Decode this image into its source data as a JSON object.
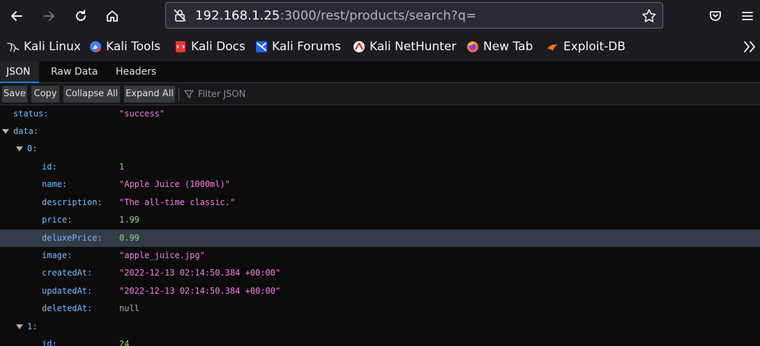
{
  "browser": {
    "url_host": "192.168.1.25",
    "url_rest": ":3000/rest/products/search?q=",
    "icons": [
      "back-icon",
      "forward-icon",
      "reload-icon",
      "home-icon",
      "lock-icon",
      "star-icon",
      "pocket-icon",
      "menu-icon"
    ]
  },
  "bookmarks": [
    {
      "label": "Kali Linux",
      "icon": "kali-dragon-icon"
    },
    {
      "label": "Kali Tools",
      "icon": "kali-tools-icon"
    },
    {
      "label": "Kali Docs",
      "icon": "kali-docs-icon"
    },
    {
      "label": "Kali Forums",
      "icon": "kali-forums-icon"
    },
    {
      "label": "Kali NetHunter",
      "icon": "kali-nethunter-icon"
    },
    {
      "label": "New Tab",
      "icon": "firefox-icon"
    },
    {
      "label": "Exploit-DB",
      "icon": "exploit-db-icon"
    }
  ],
  "viewer": {
    "tabs": [
      {
        "label": "JSON",
        "active": true
      },
      {
        "label": "Raw Data",
        "active": false
      },
      {
        "label": "Headers",
        "active": false
      }
    ],
    "toolbar": {
      "save": "Save",
      "copy": "Copy",
      "collapse_all": "Collapse All",
      "expand_all": "Expand All",
      "filter_placeholder": "Filter JSON"
    }
  },
  "tree": {
    "status_key": "status:",
    "status_val": "\"success\"",
    "data_key": "data:",
    "item0_key": "0:",
    "item0": [
      {
        "key": "id:",
        "value": "1",
        "kind": "num"
      },
      {
        "key": "name:",
        "value": "\"Apple Juice (1000ml)\"",
        "kind": "str"
      },
      {
        "key": "description:",
        "value": "\"The all-time classic.\"",
        "kind": "str"
      },
      {
        "key": "price:",
        "value": "1.99",
        "kind": "num"
      },
      {
        "key": "deluxePrice:",
        "value": "0.99",
        "kind": "num"
      },
      {
        "key": "image:",
        "value": "\"apple_juice.jpg\"",
        "kind": "str"
      },
      {
        "key": "createdAt:",
        "value": "\"2022-12-13 02:14:50.384 +00:00\"",
        "kind": "str"
      },
      {
        "key": "updatedAt:",
        "value": "\"2022-12-13 02:14:50.384 +00:00\"",
        "kind": "str"
      },
      {
        "key": "deletedAt:",
        "value": "null",
        "kind": "nul"
      }
    ],
    "item1_key": "1:",
    "item1_id_key": "id:",
    "item1_id_val": "24"
  }
}
